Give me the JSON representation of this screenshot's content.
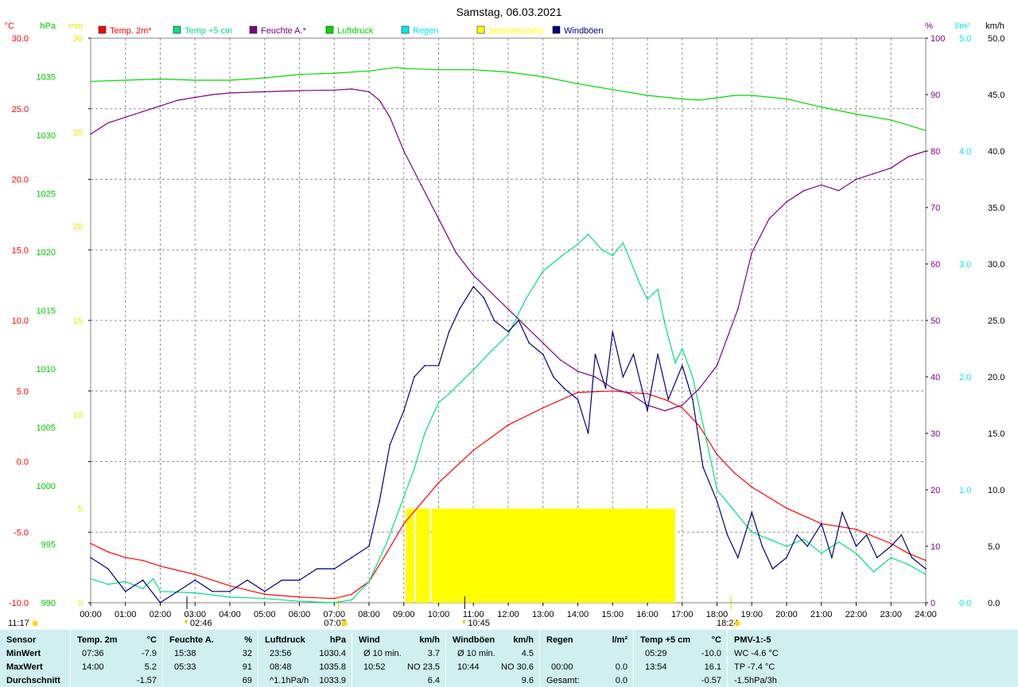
{
  "title": "Samstag, 06.03.2021",
  "legend": [
    {
      "label": "Temp. 2m*",
      "color": "#ff0000"
    },
    {
      "label": "Temp +5 cm",
      "color": "#00e080"
    },
    {
      "label": "Feuchte A.*",
      "color": "#800080"
    },
    {
      "label": "Luftdruck",
      "color": "#00d800"
    },
    {
      "label": "Regen",
      "color": "#00e8e8"
    },
    {
      "label": "Sonnenschein",
      "color": "#ffff00"
    },
    {
      "label": "Windböen",
      "color": "#000080"
    }
  ],
  "axes": {
    "celsius": {
      "unit": "°C",
      "ticks": [
        "30.0",
        "25.0",
        "20.0",
        "15.0",
        "10.0",
        "5.0",
        "0.0",
        "-5.0",
        "-10.0"
      ],
      "color": "#ff0000",
      "range": [
        -10,
        30
      ]
    },
    "hpa": {
      "unit": "hPa",
      "ticks": [
        "1035",
        "1030",
        "1025",
        "1020",
        "1015",
        "1010",
        "1005",
        "1000",
        "995",
        "990"
      ],
      "color": "#00c800",
      "range": [
        990,
        1038.3
      ]
    },
    "min": {
      "unit": "min",
      "ticks": [
        "30",
        "25",
        "20",
        "15",
        "10",
        "5",
        "0"
      ],
      "color": "#e8e800",
      "range": [
        0,
        30
      ]
    },
    "percent": {
      "unit": "%",
      "ticks": [
        "100",
        "90",
        "80",
        "70",
        "60",
        "50",
        "40",
        "30",
        "20",
        "10",
        "0"
      ],
      "color": "#800080",
      "range": [
        0,
        100
      ]
    },
    "rain": {
      "unit": "l/m²",
      "ticks": [
        "5.0",
        "4.0",
        "3.0",
        "2.0",
        "1.0",
        "0.0"
      ],
      "color": "#00e8e8",
      "range": [
        0,
        5
      ]
    },
    "kmh": {
      "unit": "km/h",
      "ticks": [
        "50.0",
        "45.0",
        "40.0",
        "35.0",
        "30.0",
        "25.0",
        "20.0",
        "15.0",
        "10.0",
        "5.0",
        "0.0"
      ],
      "color": "#000000",
      "range": [
        0,
        50
      ]
    },
    "time_labels": [
      "00:00",
      "01:00",
      "02:00",
      "03:00",
      "04:00",
      "05:00",
      "06:00",
      "07:00",
      "08:00",
      "09:00",
      "10:00",
      "11:00",
      "12:00",
      "13:00",
      "14:00",
      "15:00",
      "16:00",
      "17:00",
      "18:00",
      "19:00",
      "20:00",
      "21:00",
      "22:00",
      "23:00",
      "24:00"
    ]
  },
  "markers": [
    {
      "label": "11:17",
      "x_hours": null,
      "kind": "sun"
    },
    {
      "label": "02:46",
      "x_hours": 2.767,
      "kind": "moon"
    },
    {
      "label": "07:07",
      "x_hours": 7.117,
      "kind": "sun"
    },
    {
      "label": "10:45",
      "x_hours": 10.75,
      "kind": "moon"
    },
    {
      "label": "18:24",
      "x_hours": 18.4,
      "kind": "sun"
    }
  ],
  "chart_data": {
    "type": "line",
    "title": "Samstag, 06.03.2021",
    "x_range_hours": [
      0,
      24
    ],
    "series": [
      {
        "name": "Temp. 2m*",
        "axis": "celsius",
        "color": "#ff0000",
        "x": [
          0,
          0.5,
          1,
          1.5,
          2,
          3,
          4,
          5,
          6,
          7,
          7.5,
          8,
          8.5,
          9,
          10,
          11,
          12,
          13,
          14,
          15,
          16,
          16.5,
          17,
          17.5,
          18,
          18.5,
          19,
          20,
          21,
          22,
          23,
          23.5,
          24
        ],
        "y": [
          -5.8,
          -6.4,
          -6.8,
          -7.0,
          -7.4,
          -8.0,
          -8.8,
          -9.4,
          -9.6,
          -9.7,
          -9.4,
          -8.5,
          -6.5,
          -4.4,
          -1.5,
          0.8,
          2.6,
          3.8,
          4.9,
          5.0,
          4.8,
          4.4,
          3.8,
          2.5,
          0.5,
          -0.8,
          -1.8,
          -3.3,
          -4.4,
          -4.8,
          -5.8,
          -6.5,
          -7.0
        ]
      },
      {
        "name": "Temp +5 cm",
        "axis": "celsius",
        "color": "#00e080",
        "x": [
          0,
          0.5,
          1,
          1.5,
          1.8,
          2,
          3,
          4,
          5,
          6,
          7,
          7.5,
          8,
          8.5,
          9,
          9.3,
          9.6,
          10,
          10.3,
          11,
          11.5,
          12,
          12.5,
          13,
          13.5,
          14,
          14.3,
          14.7,
          15,
          15.3,
          15.5,
          15.8,
          16,
          16.3,
          16.5,
          16.8,
          17,
          17.3,
          17.7,
          18,
          18.5,
          19,
          19.5,
          20,
          20.5,
          21,
          21.5,
          22,
          22.5,
          23,
          23.5,
          24
        ],
        "y": [
          -8.3,
          -8.7,
          -8.5,
          -9.0,
          -8.3,
          -9.2,
          -9.3,
          -9.6,
          -9.7,
          -9.9,
          -10.0,
          -9.8,
          -8.5,
          -5.8,
          -2.5,
          -0.5,
          2.0,
          4.2,
          4.8,
          6.5,
          7.8,
          9.0,
          11.5,
          13.5,
          14.5,
          15.4,
          16.1,
          15.0,
          14.6,
          15.5,
          14.3,
          12.5,
          11.5,
          12.2,
          9.8,
          7.0,
          8.0,
          6.0,
          1.5,
          -2.0,
          -3.5,
          -5.0,
          -5.5,
          -6.0,
          -5.5,
          -6.5,
          -5.7,
          -6.5,
          -7.8,
          -6.8,
          -7.3,
          -8.0
        ]
      },
      {
        "name": "Feuchte A.*",
        "axis": "percent",
        "color": "#800080",
        "x": [
          0,
          0.5,
          1,
          1.5,
          2,
          2.5,
          3,
          3.5,
          4,
          5,
          6,
          7,
          7.5,
          8,
          8.3,
          8.6,
          9,
          9.5,
          10,
          10.5,
          11,
          11.5,
          12,
          12.5,
          13,
          13.5,
          14,
          14.5,
          15,
          15.5,
          16,
          16.5,
          17,
          17.5,
          18,
          18.3,
          18.6,
          19,
          19.5,
          20,
          20.5,
          21,
          21.5,
          22,
          22.5,
          23,
          23.5,
          24
        ],
        "y": [
          83,
          85,
          86,
          87,
          88,
          89,
          89.5,
          90,
          90.3,
          90.5,
          90.7,
          90.8,
          91,
          90.5,
          89,
          86,
          80,
          74,
          68,
          62,
          58,
          55,
          52,
          49,
          46,
          43,
          41,
          40,
          38,
          37,
          35,
          34,
          35,
          38,
          42,
          47,
          52,
          62,
          68,
          71,
          73,
          74,
          73,
          75,
          76,
          77,
          79,
          80
        ]
      },
      {
        "name": "Luftdruck",
        "axis": "hpa",
        "color": "#00d800",
        "x": [
          0,
          1,
          2,
          3,
          4,
          5,
          6,
          7,
          8,
          8.8,
          9,
          10,
          11,
          12,
          13,
          14,
          15,
          16,
          17,
          17.5,
          18,
          18.5,
          19,
          20,
          21,
          22,
          23,
          24
        ],
        "y": [
          1034.6,
          1034.7,
          1034.8,
          1034.7,
          1034.7,
          1034.9,
          1035.2,
          1035.3,
          1035.5,
          1035.8,
          1035.7,
          1035.6,
          1035.6,
          1035.4,
          1035.0,
          1034.4,
          1033.9,
          1033.4,
          1033.1,
          1033.0,
          1033.2,
          1033.4,
          1033.4,
          1033.1,
          1032.4,
          1031.8,
          1031.3,
          1030.4
        ]
      },
      {
        "name": "Windböen",
        "axis": "kmh",
        "color": "#000080",
        "x": [
          0,
          0.5,
          1,
          1.5,
          2,
          2.5,
          3,
          3.5,
          4,
          4.5,
          5,
          5.5,
          6,
          6.5,
          7,
          7.5,
          8,
          8.3,
          8.6,
          9,
          9.3,
          9.6,
          10,
          10.3,
          10.6,
          11,
          11.3,
          11.6,
          12,
          12.3,
          12.6,
          13,
          13.3,
          13.6,
          14,
          14.3,
          14.5,
          14.8,
          15,
          15.3,
          15.6,
          16,
          16.3,
          16.6,
          17,
          17.3,
          17.6,
          18,
          18.3,
          18.6,
          19,
          19.3,
          19.6,
          20,
          20.3,
          20.6,
          21,
          21.3,
          21.6,
          22,
          22.3,
          22.6,
          23,
          23.3,
          23.6,
          24
        ],
        "y": [
          4,
          3,
          1,
          2,
          0,
          1,
          2,
          1,
          1,
          2,
          1,
          2,
          2,
          3,
          3,
          4,
          5,
          9,
          14,
          17,
          20,
          21,
          21,
          24,
          26,
          28,
          27,
          25,
          24,
          25,
          23,
          22,
          20,
          19,
          18,
          15,
          22,
          19,
          24,
          20,
          22,
          17,
          22,
          18,
          21,
          18,
          12,
          9,
          6,
          4,
          8,
          5,
          3,
          4,
          6,
          5,
          7,
          4,
          8,
          5,
          6,
          4,
          5,
          6,
          4,
          3
        ]
      }
    ],
    "sunshine_blocks_hours": [
      [
        9.05,
        9.3
      ],
      [
        9.35,
        9.75
      ],
      [
        9.8,
        16.8
      ]
    ],
    "sunshine_value_min": 5
  },
  "stats": [
    {
      "title": "Sensor",
      "unit": "",
      "rows": [
        {
          "label": "MinWert",
          "time": "",
          "value": ""
        },
        {
          "label": "MaxWert",
          "time": "",
          "value": ""
        },
        {
          "label": "Durchschnitt",
          "time": "",
          "value": ""
        }
      ]
    },
    {
      "title": "Temp. 2m",
      "unit": "°C",
      "rows": [
        {
          "label": "",
          "time": "07:36",
          "value": "-7.9"
        },
        {
          "label": "",
          "time": "14:00",
          "value": "5.2"
        },
        {
          "label": "",
          "time": "",
          "value": "-1.57"
        }
      ]
    },
    {
      "title": "Feuchte A.",
      "unit": "%",
      "rows": [
        {
          "label": "",
          "time": "15:38",
          "value": "32"
        },
        {
          "label": "",
          "time": "05:33",
          "value": "91"
        },
        {
          "label": "",
          "time": "",
          "value": "69"
        }
      ]
    },
    {
      "title": "Luftdruck",
      "unit": "hPa",
      "rows": [
        {
          "label": "",
          "time": "23:56",
          "value": "1030.4"
        },
        {
          "label": "",
          "time": "08:48",
          "value": "1035.8"
        },
        {
          "label": "",
          "time": "^1.1hPa/h",
          "value": "1033.9"
        }
      ]
    },
    {
      "title": "Wind",
      "unit": "km/h",
      "rows": [
        {
          "label": "",
          "time": "Ø 10 min.",
          "value": "3.7"
        },
        {
          "label": "",
          "time": "10:52",
          "value": "NO 23.5"
        },
        {
          "label": "",
          "time": "",
          "value": "6.4"
        }
      ]
    },
    {
      "title": "Windböen",
      "unit": "km/h",
      "rows": [
        {
          "label": "",
          "time": "Ø 10 min.",
          "value": "4.5"
        },
        {
          "label": "",
          "time": "10:44",
          "value": "NO 30.6"
        },
        {
          "label": "",
          "time": "",
          "value": "9.6"
        }
      ]
    },
    {
      "title": "Regen",
      "unit": "l/m²",
      "rows": [
        {
          "label": "",
          "time": "",
          "value": ""
        },
        {
          "label": "",
          "time": "00:00",
          "value": "0.0"
        },
        {
          "label": "Gesamt:",
          "time": "",
          "value": "0.0"
        }
      ]
    },
    {
      "title": "Temp +5 cm",
      "unit": "°C",
      "rows": [
        {
          "label": "",
          "time": "05:29",
          "value": "-10.0"
        },
        {
          "label": "",
          "time": "13:54",
          "value": "16.1"
        },
        {
          "label": "",
          "time": "",
          "value": "-0.57"
        }
      ]
    },
    {
      "title": "PMV-1:-5",
      "unit": "",
      "rows": [
        {
          "label": "",
          "time": "WC -4.6 °C",
          "value": ""
        },
        {
          "label": "",
          "time": "TP -7.4 °C",
          "value": ""
        },
        {
          "label": "",
          "time": "-1.5hPa/3h",
          "value": ""
        }
      ]
    }
  ]
}
